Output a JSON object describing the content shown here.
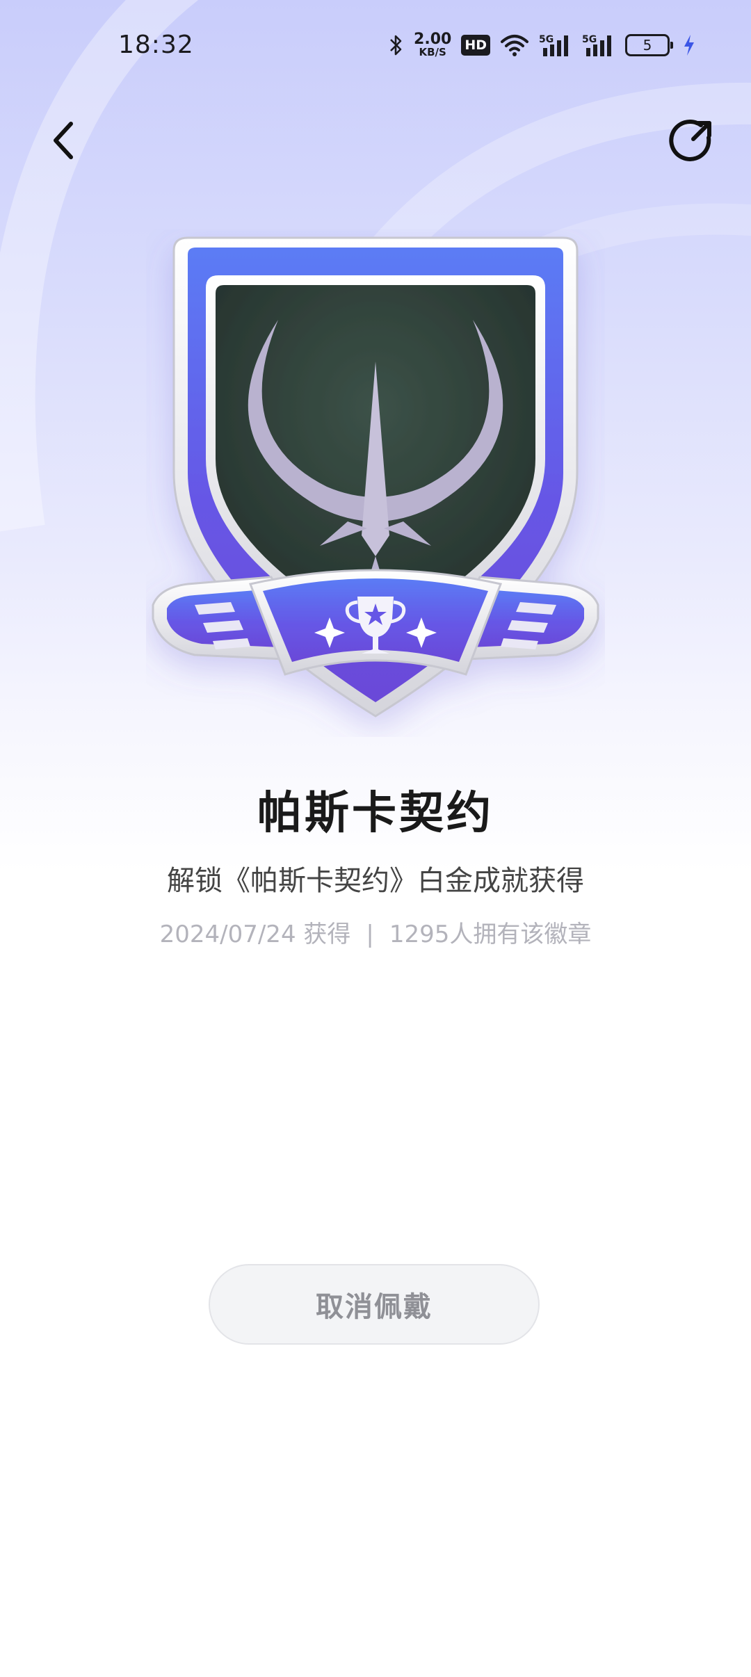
{
  "status_bar": {
    "time": "18:32",
    "net_speed_value": "2.00",
    "net_speed_unit": "KB/S",
    "hd_label": "HD",
    "signal_1_label": "5G",
    "signal_2_label": "5G",
    "battery_level": "5",
    "icons": [
      "bluetooth-icon",
      "wifi-icon",
      "signal-icon",
      "battery-icon",
      "charging-icon"
    ]
  },
  "nav": {
    "back_icon": "chevron-left-icon",
    "share_icon": "share-icon"
  },
  "badge": {
    "title": "帕斯卡契约",
    "description": "解锁《帕斯卡契约》白金成就获得",
    "date": "2024/07/24 获得",
    "separator": "|",
    "owners": "1295人拥有该徽章",
    "colors": {
      "frame_top": "#5b7cf5",
      "frame_bottom": "#6a49d8",
      "inner_panel": "#2b3a35",
      "emblem": "#b9b2cf"
    }
  },
  "actions": {
    "cancel_wear_label": "取消佩戴"
  }
}
